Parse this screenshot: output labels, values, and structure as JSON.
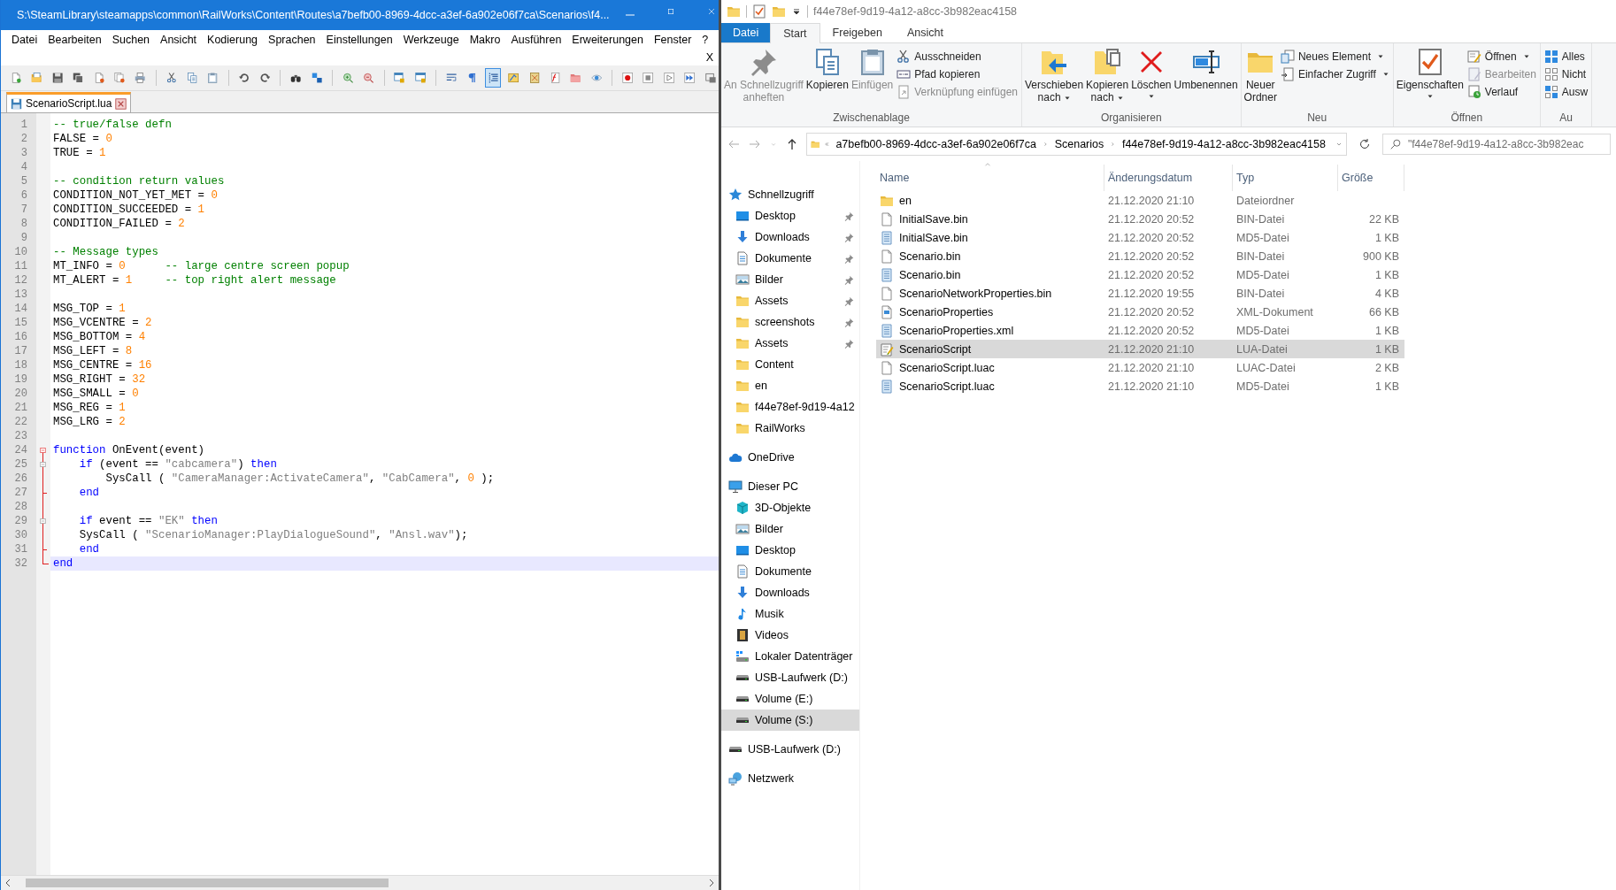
{
  "editor": {
    "title": "S:\\SteamLibrary\\steamapps\\common\\RailWorks\\Content\\Routes\\a7befb00-8969-4dcc-a3ef-6a902e06f7ca\\Scenarios\\f4...",
    "menu": [
      "Datei",
      "Bearbeiten",
      "Suchen",
      "Ansicht",
      "Kodierung",
      "Sprachen",
      "Einstellungen",
      "Werkzeuge",
      "Makro",
      "Ausführen",
      "Erweiterungen",
      "Fenster",
      "?"
    ],
    "close_document": "X",
    "toolbar": [
      [
        {
          "kind": "new",
          "pressed": false
        },
        {
          "kind": "open",
          "pressed": false
        },
        {
          "kind": "save",
          "pressed": false
        },
        {
          "kind": "saveall",
          "pressed": false
        },
        {
          "kind": "close",
          "pressed": false
        },
        {
          "kind": "closeall",
          "pressed": false
        },
        {
          "kind": "print",
          "pressed": false
        }
      ],
      [
        {
          "kind": "cut",
          "pressed": false
        },
        {
          "kind": "copy",
          "pressed": false
        },
        {
          "kind": "paste",
          "pressed": false
        }
      ],
      [
        {
          "kind": "undo",
          "pressed": false
        },
        {
          "kind": "redo",
          "pressed": false
        }
      ],
      [
        {
          "kind": "find",
          "pressed": false
        },
        {
          "kind": "replace",
          "pressed": false
        }
      ],
      [
        {
          "kind": "zoomin",
          "pressed": false
        },
        {
          "kind": "zoomout",
          "pressed": false
        }
      ],
      [
        {
          "kind": "syncv",
          "pressed": false
        },
        {
          "kind": "synch",
          "pressed": false
        }
      ],
      [
        {
          "kind": "wrap",
          "pressed": false
        },
        {
          "kind": "pilcrow",
          "pressed": false
        },
        {
          "kind": "indent",
          "pressed": true
        },
        {
          "kind": "lang",
          "pressed": false
        },
        {
          "kind": "docmap",
          "pressed": false
        },
        {
          "kind": "funclist",
          "pressed": false
        },
        {
          "kind": "folder",
          "pressed": false
        },
        {
          "kind": "monitor",
          "pressed": false
        }
      ],
      [
        {
          "kind": "record",
          "pressed": false
        },
        {
          "kind": "stop",
          "pressed": false
        },
        {
          "kind": "play",
          "pressed": false
        },
        {
          "kind": "playmulti",
          "pressed": false
        },
        {
          "kind": "savemacro",
          "pressed": false
        }
      ]
    ],
    "tabs": [
      {
        "label": "ScenarioScript.lua",
        "selected": true
      }
    ],
    "lines": [
      {
        "number": "1",
        "tokens": [
          {
            "kind": "comment",
            "text": "-- true/false defn"
          }
        ]
      },
      {
        "number": "2",
        "tokens": [
          {
            "kind": "plain",
            "text": "FALSE = "
          },
          {
            "kind": "number",
            "text": "0"
          }
        ]
      },
      {
        "number": "3",
        "tokens": [
          {
            "kind": "plain",
            "text": "TRUE = "
          },
          {
            "kind": "number",
            "text": "1"
          }
        ]
      },
      {
        "number": "4"
      },
      {
        "number": "5",
        "tokens": [
          {
            "kind": "comment",
            "text": "-- condition return values"
          }
        ]
      },
      {
        "number": "6",
        "tokens": [
          {
            "kind": "plain",
            "text": "CONDITION_NOT_YET_MET = "
          },
          {
            "kind": "number",
            "text": "0"
          }
        ]
      },
      {
        "number": "7",
        "tokens": [
          {
            "kind": "plain",
            "text": "CONDITION_SUCCEEDED = "
          },
          {
            "kind": "number",
            "text": "1"
          }
        ]
      },
      {
        "number": "8",
        "tokens": [
          {
            "kind": "plain",
            "text": "CONDITION_FAILED = "
          },
          {
            "kind": "number",
            "text": "2"
          }
        ]
      },
      {
        "number": "9"
      },
      {
        "number": "10",
        "tokens": [
          {
            "kind": "comment",
            "text": "-- Message types"
          }
        ]
      },
      {
        "number": "11",
        "tokens": [
          {
            "kind": "plain",
            "text": "MT_INFO = "
          },
          {
            "kind": "number",
            "text": "0"
          },
          {
            "kind": "comment",
            "text": "      -- large centre screen popup"
          }
        ]
      },
      {
        "number": "12",
        "tokens": [
          {
            "kind": "plain",
            "text": "MT_ALERT = "
          },
          {
            "kind": "number",
            "text": "1"
          },
          {
            "kind": "comment",
            "text": "     -- top right alert message"
          }
        ]
      },
      {
        "number": "13"
      },
      {
        "number": "14",
        "tokens": [
          {
            "kind": "plain",
            "text": "MSG_TOP = "
          },
          {
            "kind": "number",
            "text": "1"
          }
        ]
      },
      {
        "number": "15",
        "tokens": [
          {
            "kind": "plain",
            "text": "MSG_VCENTRE = "
          },
          {
            "kind": "number",
            "text": "2"
          }
        ]
      },
      {
        "number": "16",
        "tokens": [
          {
            "kind": "plain",
            "text": "MSG_BOTTOM = "
          },
          {
            "kind": "number",
            "text": "4"
          }
        ]
      },
      {
        "number": "17",
        "tokens": [
          {
            "kind": "plain",
            "text": "MSG_LEFT = "
          },
          {
            "kind": "number",
            "text": "8"
          }
        ]
      },
      {
        "number": "18",
        "tokens": [
          {
            "kind": "plain",
            "text": "MSG_CENTRE = "
          },
          {
            "kind": "number",
            "text": "16"
          }
        ]
      },
      {
        "number": "19",
        "tokens": [
          {
            "kind": "plain",
            "text": "MSG_RIGHT = "
          },
          {
            "kind": "number",
            "text": "32"
          }
        ]
      },
      {
        "number": "20",
        "tokens": [
          {
            "kind": "plain",
            "text": "MSG_SMALL = "
          },
          {
            "kind": "number",
            "text": "0"
          }
        ]
      },
      {
        "number": "21",
        "tokens": [
          {
            "kind": "plain",
            "text": "MSG_REG = "
          },
          {
            "kind": "number",
            "text": "1"
          }
        ]
      },
      {
        "number": "22",
        "tokens": [
          {
            "kind": "plain",
            "text": "MSG_LRG = "
          },
          {
            "kind": "number",
            "text": "2"
          }
        ]
      },
      {
        "number": "23"
      },
      {
        "number": "24",
        "kind": "box",
        "tokens": [
          {
            "kind": "keyword",
            "text": "function"
          },
          {
            "kind": "plain",
            "text": " OnEvent(event)"
          }
        ]
      },
      {
        "number": "25",
        "kind": "subbox",
        "tokens": [
          {
            "kind": "keyword",
            "text": "    if"
          },
          {
            "kind": "plain",
            "text": " (event == "
          },
          {
            "kind": "string",
            "text": "\"cabcamera\""
          },
          {
            "kind": "plain",
            "text": ") "
          },
          {
            "kind": "keyword",
            "text": "then"
          }
        ]
      },
      {
        "number": "26",
        "kind": "line",
        "tokens": [
          {
            "kind": "plain",
            "text": "        SysCall ( "
          },
          {
            "kind": "string",
            "text": "\"CameraManager:ActivateCamera\""
          },
          {
            "kind": "plain",
            "text": ", "
          },
          {
            "kind": "string",
            "text": "\"CabCamera\""
          },
          {
            "kind": "plain",
            "text": ", "
          },
          {
            "kind": "number",
            "text": "0"
          },
          {
            "kind": "plain",
            "text": " );"
          }
        ]
      },
      {
        "number": "27",
        "kind": "tail",
        "tokens": [
          {
            "kind": "keyword",
            "text": "    end"
          }
        ]
      },
      {
        "number": "28",
        "kind": "line"
      },
      {
        "number": "29",
        "kind": "subbox",
        "tokens": [
          {
            "kind": "keyword",
            "text": "    if"
          },
          {
            "kind": "plain",
            "text": " event == "
          },
          {
            "kind": "string",
            "text": "\"EK\""
          },
          {
            "kind": "keyword",
            "text": " then"
          }
        ]
      },
      {
        "number": "30",
        "kind": "line",
        "tokens": [
          {
            "kind": "plain",
            "text": "    SysCall ( "
          },
          {
            "kind": "string",
            "text": "\"ScenarioManager:PlayDialogueSound\""
          },
          {
            "kind": "plain",
            "text": ", "
          },
          {
            "kind": "string",
            "text": "\"Ansl.wav\""
          },
          {
            "kind": "plain",
            "text": ");"
          }
        ]
      },
      {
        "number": "31",
        "kind": "tail",
        "tokens": [
          {
            "kind": "keyword",
            "text": "    end"
          }
        ]
      },
      {
        "number": "32",
        "kind": "end",
        "current": true,
        "tokens": [
          {
            "kind": "keyword",
            "text": "end"
          }
        ]
      }
    ]
  },
  "explorer": {
    "title": "f44e78ef-9d19-4a12-a8cc-3b982eac4158",
    "ribbon_tabs": [
      {
        "label": "Datei",
        "kind": "file",
        "selected": false
      },
      {
        "label": "Start",
        "kind": "tab",
        "selected": true
      },
      {
        "label": "Freigeben",
        "kind": "tab",
        "selected": false
      },
      {
        "label": "Ansicht",
        "kind": "tab",
        "selected": false
      }
    ],
    "ribbon_groups": [
      {
        "label": "Zwischenablage",
        "large": [
          {
            "label": "An Schnellzugriff\nanheften",
            "kind": "pin",
            "disabled": true
          },
          {
            "label": "Kopieren",
            "kind": "copy",
            "disabled": false
          },
          {
            "label": "Einfügen",
            "kind": "paste",
            "disabled": true
          }
        ],
        "small": [
          {
            "label": "Ausschneiden",
            "kind": "cut",
            "disabled": false
          },
          {
            "label": "Pfad kopieren",
            "kind": "path",
            "disabled": false
          },
          {
            "label": "Verknüpfung einfügen",
            "kind": "shortcut",
            "disabled": true
          }
        ]
      },
      {
        "label": "Organisieren",
        "large": [
          {
            "label": "Verschieben\nnach",
            "kind": "move",
            "dropdown": true
          },
          {
            "label": "Kopieren\nnach",
            "kind": "copyto",
            "dropdown": true
          },
          {
            "label": "Löschen",
            "kind": "delete",
            "dropdown": true
          },
          {
            "label": "Umbenennen",
            "kind": "rename",
            "dropdown": false
          }
        ]
      },
      {
        "label": "Neu",
        "large": [
          {
            "label": "Neuer\nOrdner",
            "kind": "folder",
            "dropdown": false
          }
        ],
        "small": [
          {
            "label": "Neues Element",
            "kind": "newitem",
            "dropdown": true
          },
          {
            "label": "Einfacher Zugriff",
            "kind": "easyaccess",
            "dropdown": true
          }
        ]
      },
      {
        "label": "Öffnen",
        "large": [
          {
            "label": "Eigenschaften",
            "kind": "properties",
            "dropdown": true
          }
        ],
        "small": [
          {
            "label": "Öffnen",
            "kind": "open",
            "dropdown": true,
            "disabled": false
          },
          {
            "label": "Bearbeiten",
            "kind": "edit",
            "disabled": true
          },
          {
            "label": "Verlauf",
            "kind": "history",
            "disabled": false
          }
        ]
      },
      {
        "label": "Au",
        "small": [
          {
            "label": "Alles",
            "kind": "selectall"
          },
          {
            "label": "Nicht",
            "kind": "selectnone"
          },
          {
            "label": "Ausw",
            "kind": "invert"
          }
        ]
      }
    ],
    "address": {
      "segments": [
        "a7befb00-8969-4dcc-a3ef-6a902e06f7ca",
        "Scenarios",
        "f44e78ef-9d19-4a12-a8cc-3b982eac4158"
      ]
    },
    "search": {
      "placeholder": "\"f44e78ef-9d19-4a12-a8cc-3b982eac"
    },
    "nav": [
      {
        "label": "Schnellzugriff",
        "kind": "star",
        "children": [
          {
            "label": "Desktop",
            "kind": "desktop",
            "pinned": true,
            "selected": false
          },
          {
            "label": "Downloads",
            "kind": "download",
            "pinned": true,
            "selected": false
          },
          {
            "label": "Dokumente",
            "kind": "document",
            "pinned": true,
            "selected": false
          },
          {
            "label": "Bilder",
            "kind": "pictures",
            "pinned": true,
            "selected": false
          },
          {
            "label": "Assets",
            "kind": "folder",
            "pinned": true,
            "selected": false
          },
          {
            "label": "screenshots",
            "kind": "folder",
            "pinned": true,
            "selected": false
          },
          {
            "label": "Assets",
            "kind": "folder",
            "pinned": true,
            "selected": false
          },
          {
            "label": "Content",
            "kind": "folder",
            "pinned": false,
            "selected": false
          },
          {
            "label": "en",
            "kind": "folder",
            "pinned": false,
            "selected": false
          },
          {
            "label": "f44e78ef-9d19-4a12",
            "kind": "folder",
            "pinned": false,
            "selected": false
          },
          {
            "label": "RailWorks",
            "kind": "folder",
            "pinned": false,
            "selected": false
          }
        ]
      },
      {
        "label": "OneDrive",
        "kind": "cloud"
      },
      {
        "label": "Dieser PC",
        "kind": "pc",
        "children": [
          {
            "label": "3D-Objekte",
            "kind": "cube",
            "pinned": false,
            "selected": false
          },
          {
            "label": "Bilder",
            "kind": "pictures",
            "pinned": false,
            "selected": false
          },
          {
            "label": "Desktop",
            "kind": "desktop",
            "pinned": false,
            "selected": false
          },
          {
            "label": "Dokumente",
            "kind": "document",
            "pinned": false,
            "selected": false
          },
          {
            "label": "Downloads",
            "kind": "download",
            "pinned": false,
            "selected": false
          },
          {
            "label": "Musik",
            "kind": "music",
            "pinned": false,
            "selected": false
          },
          {
            "label": "Videos",
            "kind": "video",
            "pinned": false,
            "selected": false
          },
          {
            "label": "Lokaler Datenträger",
            "kind": "localdisk",
            "pinned": false,
            "selected": false
          },
          {
            "label": "USB-Laufwerk (D:)",
            "kind": "drive",
            "pinned": false,
            "selected": false
          },
          {
            "label": "Volume (E:)",
            "kind": "drive",
            "pinned": false,
            "selected": false
          },
          {
            "label": "Volume (S:)",
            "kind": "drive",
            "pinned": false,
            "selected": true
          }
        ]
      },
      {
        "label": "USB-Laufwerk (D:)",
        "kind": "drive"
      },
      {
        "label": "Netzwerk",
        "kind": "network"
      }
    ],
    "columns": [
      "Name",
      "Änderungsdatum",
      "Typ",
      "Größe"
    ],
    "rows": [
      {
        "name": "en",
        "date": "21.12.2020 21:10",
        "type": "Dateiordner",
        "kind": "folder",
        "selected": false
      },
      {
        "name": "InitialSave.bin",
        "date": "21.12.2020 20:52",
        "type": "BIN-Datei",
        "size": "22 KB",
        "kind": "file",
        "selected": false
      },
      {
        "name": "InitialSave.bin",
        "date": "21.12.2020 20:52",
        "type": "MD5-Datei",
        "size": "1 KB",
        "kind": "md5",
        "selected": false
      },
      {
        "name": "Scenario.bin",
        "date": "21.12.2020 20:52",
        "type": "BIN-Datei",
        "size": "900 KB",
        "kind": "file",
        "selected": false
      },
      {
        "name": "Scenario.bin",
        "date": "21.12.2020 20:52",
        "type": "MD5-Datei",
        "size": "1 KB",
        "kind": "md5",
        "selected": false
      },
      {
        "name": "ScenarioNetworkProperties.bin",
        "date": "21.12.2020 19:55",
        "type": "BIN-Datei",
        "size": "4 KB",
        "kind": "file",
        "selected": false
      },
      {
        "name": "ScenarioProperties",
        "date": "21.12.2020 20:52",
        "type": "XML-Dokument",
        "size": "66 KB",
        "kind": "xml",
        "selected": false
      },
      {
        "name": "ScenarioProperties.xml",
        "date": "21.12.2020 20:52",
        "type": "MD5-Datei",
        "size": "1 KB",
        "kind": "md5",
        "selected": false
      },
      {
        "name": "ScenarioScript",
        "date": "21.12.2020 21:10",
        "type": "LUA-Datei",
        "size": "1 KB",
        "kind": "lua",
        "selected": true
      },
      {
        "name": "ScenarioScript.luac",
        "date": "21.12.2020 21:10",
        "type": "LUAC-Datei",
        "size": "2 KB",
        "kind": "file",
        "selected": false
      },
      {
        "name": "ScenarioScript.luac",
        "date": "21.12.2020 21:10",
        "type": "MD5-Datei",
        "size": "1 KB",
        "kind": "md5",
        "selected": false
      }
    ]
  }
}
